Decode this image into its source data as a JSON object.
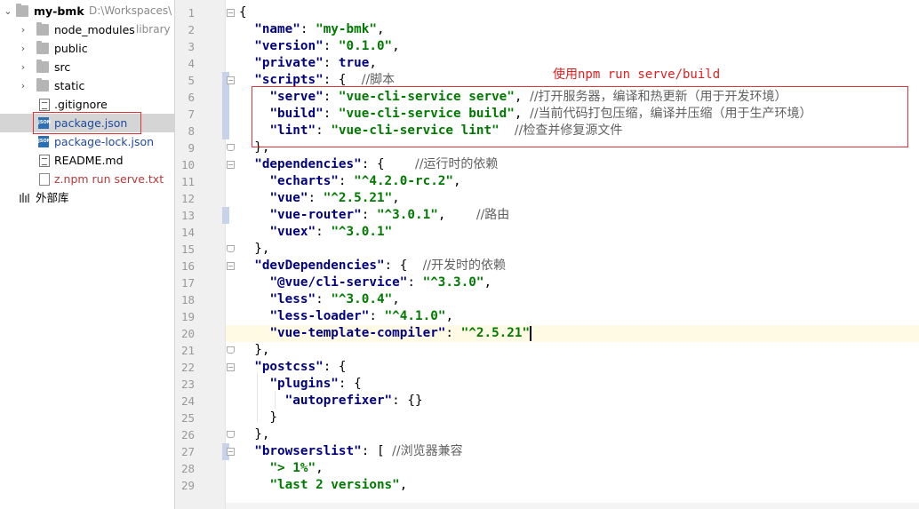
{
  "tree": {
    "project_name": "my-bmk",
    "project_path": "D:\\Workspaces\\",
    "items": [
      {
        "label": "node_modules",
        "suffix": "library",
        "kind": "folder",
        "expandable": true
      },
      {
        "label": "public",
        "kind": "folder",
        "expandable": true
      },
      {
        "label": "src",
        "kind": "folder",
        "expandable": true
      },
      {
        "label": "static",
        "kind": "folder",
        "expandable": true
      },
      {
        "label": ".gitignore",
        "kind": "file"
      },
      {
        "label": "package.json",
        "kind": "json",
        "selected": true
      },
      {
        "label": "package-lock.json",
        "kind": "json"
      },
      {
        "label": "README.md",
        "kind": "file"
      },
      {
        "label": "z.npm run serve.txt",
        "kind": "txt"
      }
    ],
    "external_libraries": "外部库"
  },
  "editor": {
    "annotation": "使用npm run serve/build",
    "current_line": 20,
    "line_numbers": [
      "1",
      "2",
      "3",
      "4",
      "5",
      "6",
      "7",
      "8",
      "9",
      "10",
      "11",
      "12",
      "13",
      "14",
      "15",
      "16",
      "17",
      "18",
      "19",
      "20",
      "21",
      "22",
      "23",
      "24",
      "25",
      "26",
      "27",
      "28",
      "29"
    ],
    "lines": [
      {
        "t": [
          [
            "p",
            "{"
          ]
        ]
      },
      {
        "t": [
          [
            "p",
            "  "
          ],
          [
            "k",
            "\"name\""
          ],
          [
            "p",
            ": "
          ],
          [
            "s",
            "\"my-bmk\""
          ],
          [
            "p",
            ","
          ]
        ]
      },
      {
        "t": [
          [
            "p",
            "  "
          ],
          [
            "k",
            "\"version\""
          ],
          [
            "p",
            ": "
          ],
          [
            "s",
            "\"0.1.0\""
          ],
          [
            "p",
            ","
          ]
        ]
      },
      {
        "t": [
          [
            "p",
            "  "
          ],
          [
            "k",
            "\"private\""
          ],
          [
            "p",
            ": "
          ],
          [
            "b",
            "true"
          ],
          [
            "p",
            ","
          ]
        ]
      },
      {
        "t": [
          [
            "p",
            "  "
          ],
          [
            "k",
            "\"scripts\""
          ],
          [
            "p",
            ": {  "
          ],
          [
            "c",
            "//脚本"
          ]
        ]
      },
      {
        "t": [
          [
            "p",
            "    "
          ],
          [
            "k",
            "\"serve\""
          ],
          [
            "p",
            ": "
          ],
          [
            "s",
            "\"vue-cli-service serve\""
          ],
          [
            "p",
            ", "
          ],
          [
            "c",
            "//打开服务器，编译和热更新（用于开发环境）"
          ]
        ]
      },
      {
        "t": [
          [
            "p",
            "    "
          ],
          [
            "k",
            "\"build\""
          ],
          [
            "p",
            ": "
          ],
          [
            "s",
            "\"vue-cli-service build\""
          ],
          [
            "p",
            ", "
          ],
          [
            "c",
            "//当前代码打包压缩，编译并压缩（用于生产环境）"
          ]
        ]
      },
      {
        "t": [
          [
            "p",
            "    "
          ],
          [
            "k",
            "\"lint\""
          ],
          [
            "p",
            ": "
          ],
          [
            "s",
            "\"vue-cli-service lint\""
          ],
          [
            "p",
            "  "
          ],
          [
            "c",
            "//检查并修复源文件"
          ]
        ]
      },
      {
        "t": [
          [
            "p",
            "  },"
          ]
        ]
      },
      {
        "t": [
          [
            "p",
            "  "
          ],
          [
            "k",
            "\"dependencies\""
          ],
          [
            "p",
            ": {    "
          ],
          [
            "c",
            "//运行时的依赖"
          ]
        ]
      },
      {
        "t": [
          [
            "p",
            "    "
          ],
          [
            "k",
            "\"echarts\""
          ],
          [
            "p",
            ": "
          ],
          [
            "s",
            "\"^4.2.0-rc.2\""
          ],
          [
            "p",
            ","
          ]
        ]
      },
      {
        "t": [
          [
            "p",
            "    "
          ],
          [
            "k",
            "\"vue\""
          ],
          [
            "p",
            ": "
          ],
          [
            "s",
            "\"^2.5.21\""
          ],
          [
            "p",
            ","
          ]
        ]
      },
      {
        "t": [
          [
            "p",
            "    "
          ],
          [
            "k",
            "\"vue-router\""
          ],
          [
            "p",
            ": "
          ],
          [
            "s",
            "\"^3.0.1\""
          ],
          [
            "p",
            ",    "
          ],
          [
            "c",
            "//路由"
          ]
        ]
      },
      {
        "t": [
          [
            "p",
            "    "
          ],
          [
            "k",
            "\"vuex\""
          ],
          [
            "p",
            ": "
          ],
          [
            "s",
            "\"^3.0.1\""
          ]
        ]
      },
      {
        "t": [
          [
            "p",
            "  },"
          ]
        ]
      },
      {
        "t": [
          [
            "p",
            "  "
          ],
          [
            "k",
            "\"devDependencies\""
          ],
          [
            "p",
            ": {  "
          ],
          [
            "c",
            "//开发时的依赖"
          ]
        ]
      },
      {
        "t": [
          [
            "p",
            "    "
          ],
          [
            "k",
            "\"@vue/cli-service\""
          ],
          [
            "p",
            ": "
          ],
          [
            "s",
            "\"^3.3.0\""
          ],
          [
            "p",
            ","
          ]
        ]
      },
      {
        "t": [
          [
            "p",
            "    "
          ],
          [
            "k",
            "\"less\""
          ],
          [
            "p",
            ": "
          ],
          [
            "s",
            "\"^3.0.4\""
          ],
          [
            "p",
            ","
          ]
        ]
      },
      {
        "t": [
          [
            "p",
            "    "
          ],
          [
            "k",
            "\"less-loader\""
          ],
          [
            "p",
            ": "
          ],
          [
            "s",
            "\"^4.1.0\""
          ],
          [
            "p",
            ","
          ]
        ]
      },
      {
        "t": [
          [
            "p",
            "    "
          ],
          [
            "k",
            "\"vue-template-compiler\""
          ],
          [
            "p",
            ": "
          ],
          [
            "s",
            "\"^2.5.21\""
          ]
        ]
      },
      {
        "t": [
          [
            "p",
            "  },"
          ]
        ]
      },
      {
        "t": [
          [
            "p",
            "  "
          ],
          [
            "k",
            "\"postcss\""
          ],
          [
            "p",
            ": {"
          ]
        ]
      },
      {
        "t": [
          [
            "p",
            "    "
          ],
          [
            "k",
            "\"plugins\""
          ],
          [
            "p",
            ": {"
          ]
        ]
      },
      {
        "t": [
          [
            "p",
            "      "
          ],
          [
            "k",
            "\"autoprefixer\""
          ],
          [
            "p",
            ": {}"
          ]
        ]
      },
      {
        "t": [
          [
            "p",
            "    }"
          ]
        ]
      },
      {
        "t": [
          [
            "p",
            "  },"
          ]
        ]
      },
      {
        "t": [
          [
            "p",
            "  "
          ],
          [
            "k",
            "\"browserslist\""
          ],
          [
            "p",
            ": [ "
          ],
          [
            "c",
            "//浏览器兼容"
          ]
        ]
      },
      {
        "t": [
          [
            "p",
            "    "
          ],
          [
            "s",
            "\"> 1%\""
          ],
          [
            "p",
            ","
          ]
        ]
      },
      {
        "t": [
          [
            "p",
            "    "
          ],
          [
            "s",
            "\"last 2 versions\""
          ],
          [
            "p",
            ","
          ]
        ]
      }
    ]
  },
  "colors": {
    "keyword": "#000080",
    "string": "#007a00",
    "comment": "#606060",
    "highlight_box": "#e0333a",
    "current_line": "#fffae3",
    "selection": "#d5d5d5"
  }
}
